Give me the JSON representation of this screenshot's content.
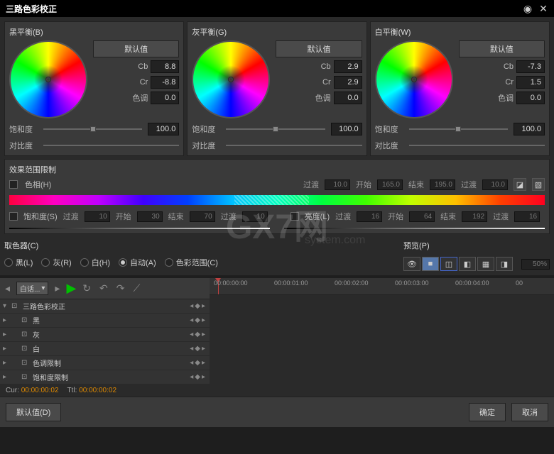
{
  "title": "三路色彩校正",
  "balance_panels": [
    {
      "title": "黑平衡(B)",
      "default_btn": "默认值",
      "cb_label": "Cb",
      "cb": "8.8",
      "cr_label": "Cr",
      "cr": "-8.8",
      "hue_label": "色调",
      "hue": "0.0",
      "sat_label": "饱和度",
      "sat": "100.0",
      "con_label": "对比度"
    },
    {
      "title": "灰平衡(G)",
      "default_btn": "默认值",
      "cb_label": "Cb",
      "cb": "2.9",
      "cr_label": "Cr",
      "cr": "2.9",
      "hue_label": "色调",
      "hue": "0.0",
      "sat_label": "饱和度",
      "sat": "100.0",
      "con_label": "对比度"
    },
    {
      "title": "白平衡(W)",
      "default_btn": "默认值",
      "cb_label": "Cb",
      "cb": "-7.3",
      "cr_label": "Cr",
      "cr": "1.5",
      "hue_label": "色调",
      "hue": "0.0",
      "sat_label": "饱和度",
      "sat": "100.0",
      "con_label": "对比度"
    }
  ],
  "limit": {
    "title": "效果范围限制",
    "hue_label": "色相(H)",
    "transition_label": "过渡",
    "transition1": "10.0",
    "start_label": "开始",
    "start": "165.0",
    "end_label": "结束",
    "end": "195.0",
    "transition2": "10.0",
    "sat_label": "饱和度(S)",
    "sat_trans_label": "过渡",
    "sat_trans1": "10",
    "sat_start_label": "开始",
    "sat_start": "30",
    "sat_end_label": "结束",
    "sat_end": "70",
    "sat_trans2": "10",
    "lum_label": "亮度(L)",
    "lum_trans_label": "过渡",
    "lum_trans1": "16",
    "lum_start_label": "开始",
    "lum_start": "64",
    "lum_end_label": "结束",
    "lum_end": "192",
    "lum_trans2": "16"
  },
  "picker": {
    "title": "取色器(C)",
    "black": "黑(L)",
    "gray": "灰(R)",
    "white": "白(H)",
    "auto": "自动(A)",
    "range": "色彩范围(C)"
  },
  "preview": {
    "title": "预览(P)",
    "percent": "50%"
  },
  "timeline": {
    "dropdown": "白话...",
    "tracks": [
      {
        "name": "三路色彩校正",
        "indent": 0
      },
      {
        "name": "黑",
        "indent": 1
      },
      {
        "name": "灰",
        "indent": 1
      },
      {
        "name": "白",
        "indent": 1
      },
      {
        "name": "色调限制",
        "indent": 1
      },
      {
        "name": "饱和度限制",
        "indent": 1
      }
    ],
    "times": [
      "00:00:00:00",
      "00:00:01:00",
      "00:00:02:00",
      "00:00:03:00",
      "00:00:04:00",
      "00"
    ]
  },
  "status": {
    "cur_label": "Cur:",
    "cur": "00:00:00:02",
    "ttl_label": "Ttl:",
    "ttl": "00:00:00:02"
  },
  "footer": {
    "default": "默认值(D)",
    "ok": "确定",
    "cancel": "取消"
  },
  "watermark": "GX7网",
  "watermark_sub": "system.com"
}
